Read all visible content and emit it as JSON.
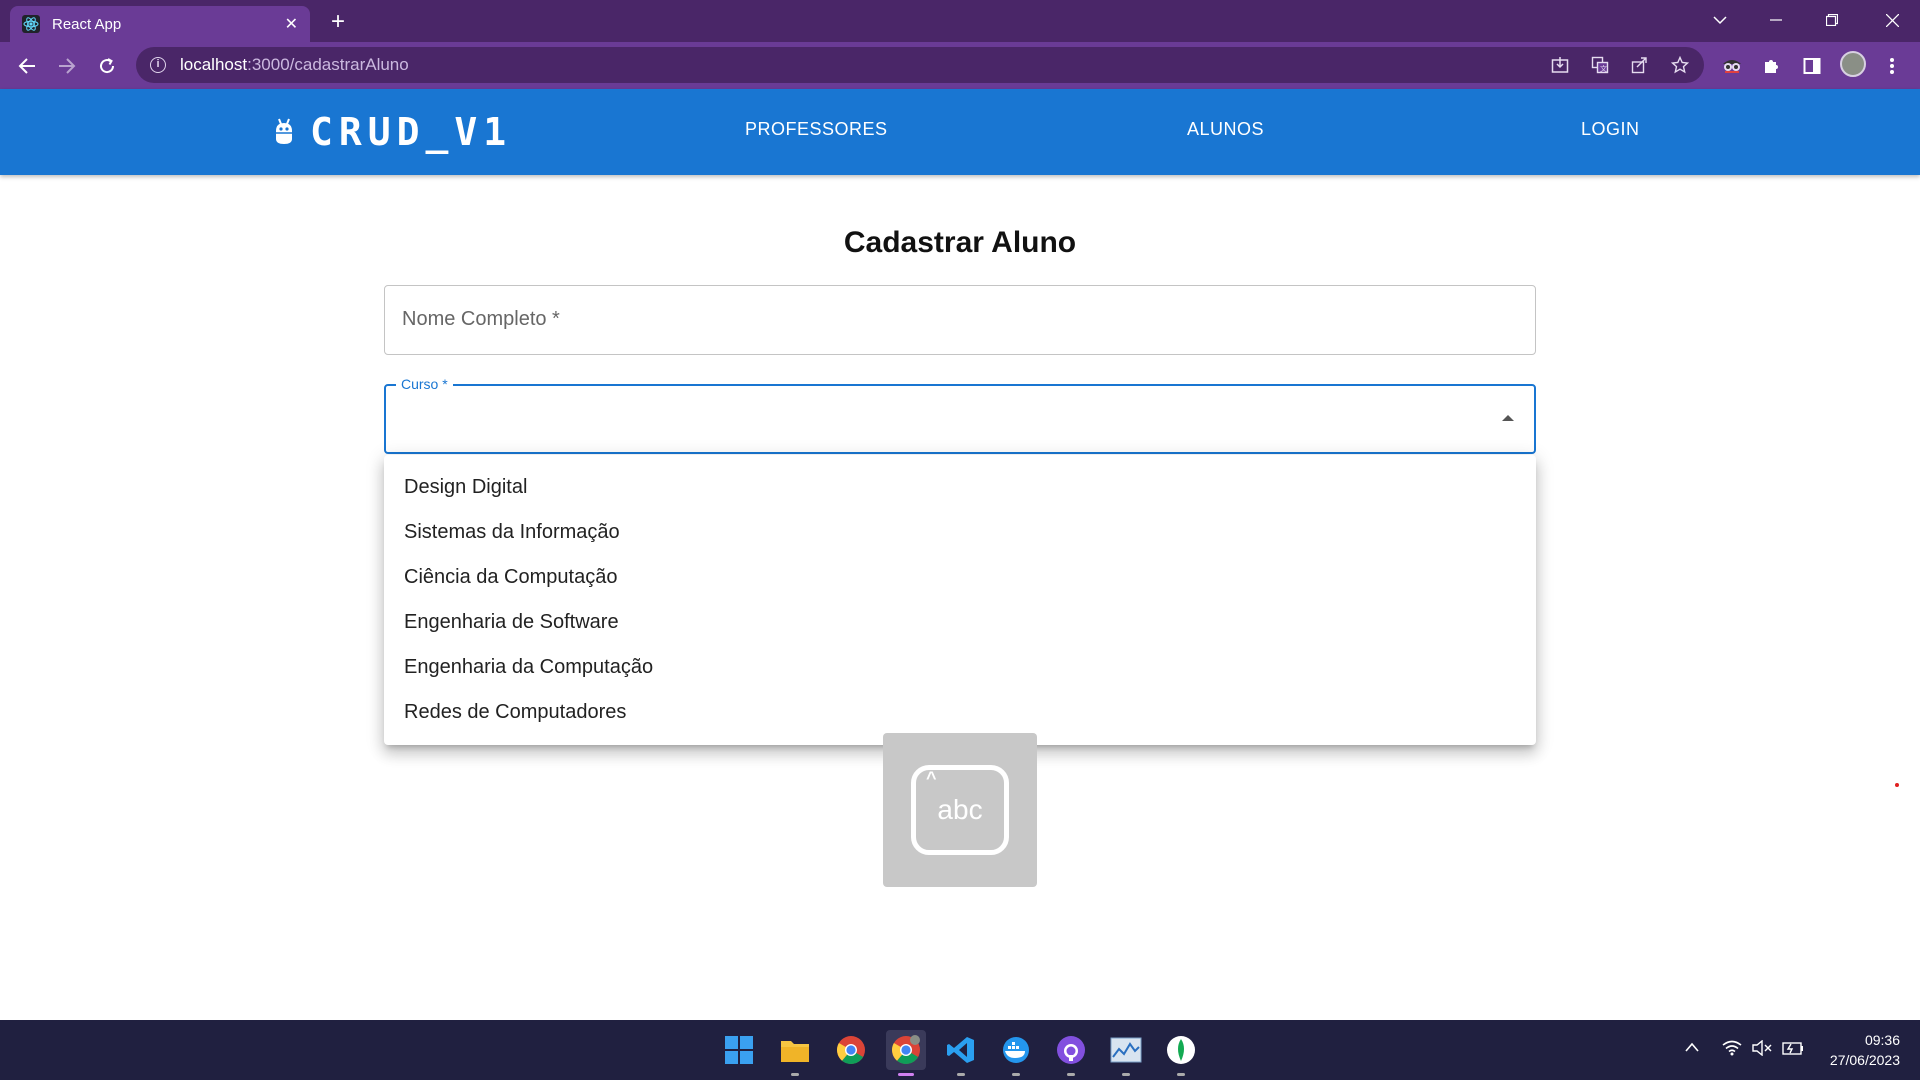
{
  "browser": {
    "tab_title": "React App",
    "tab_close": "✕",
    "new_tab": "+",
    "url_host": "localhost",
    "url_path": ":3000/cadastrarAluno"
  },
  "app": {
    "brand": "CRUD_V1",
    "nav": {
      "professores": "PROFESSORES",
      "alunos": "ALUNOS",
      "login": "LOGIN"
    }
  },
  "form": {
    "title": "Cadastrar Aluno",
    "nome_placeholder": "Nome Completo *",
    "curso_label": "Curso *"
  },
  "menu": {
    "options": [
      "Design Digital",
      "Sistemas da Informação",
      "Ciência da Computação",
      "Engenharia de Software",
      "Engenharia da Computação",
      "Redes de Computadores"
    ]
  },
  "ime": {
    "label": "abc"
  },
  "taskbar": {
    "time": "09:36",
    "date": "27/06/2023"
  },
  "colors": {
    "browser_dark": "#4a2668",
    "browser_toolbar": "#6a3b96",
    "appbar": "#1976d2",
    "taskbar": "#202040"
  }
}
